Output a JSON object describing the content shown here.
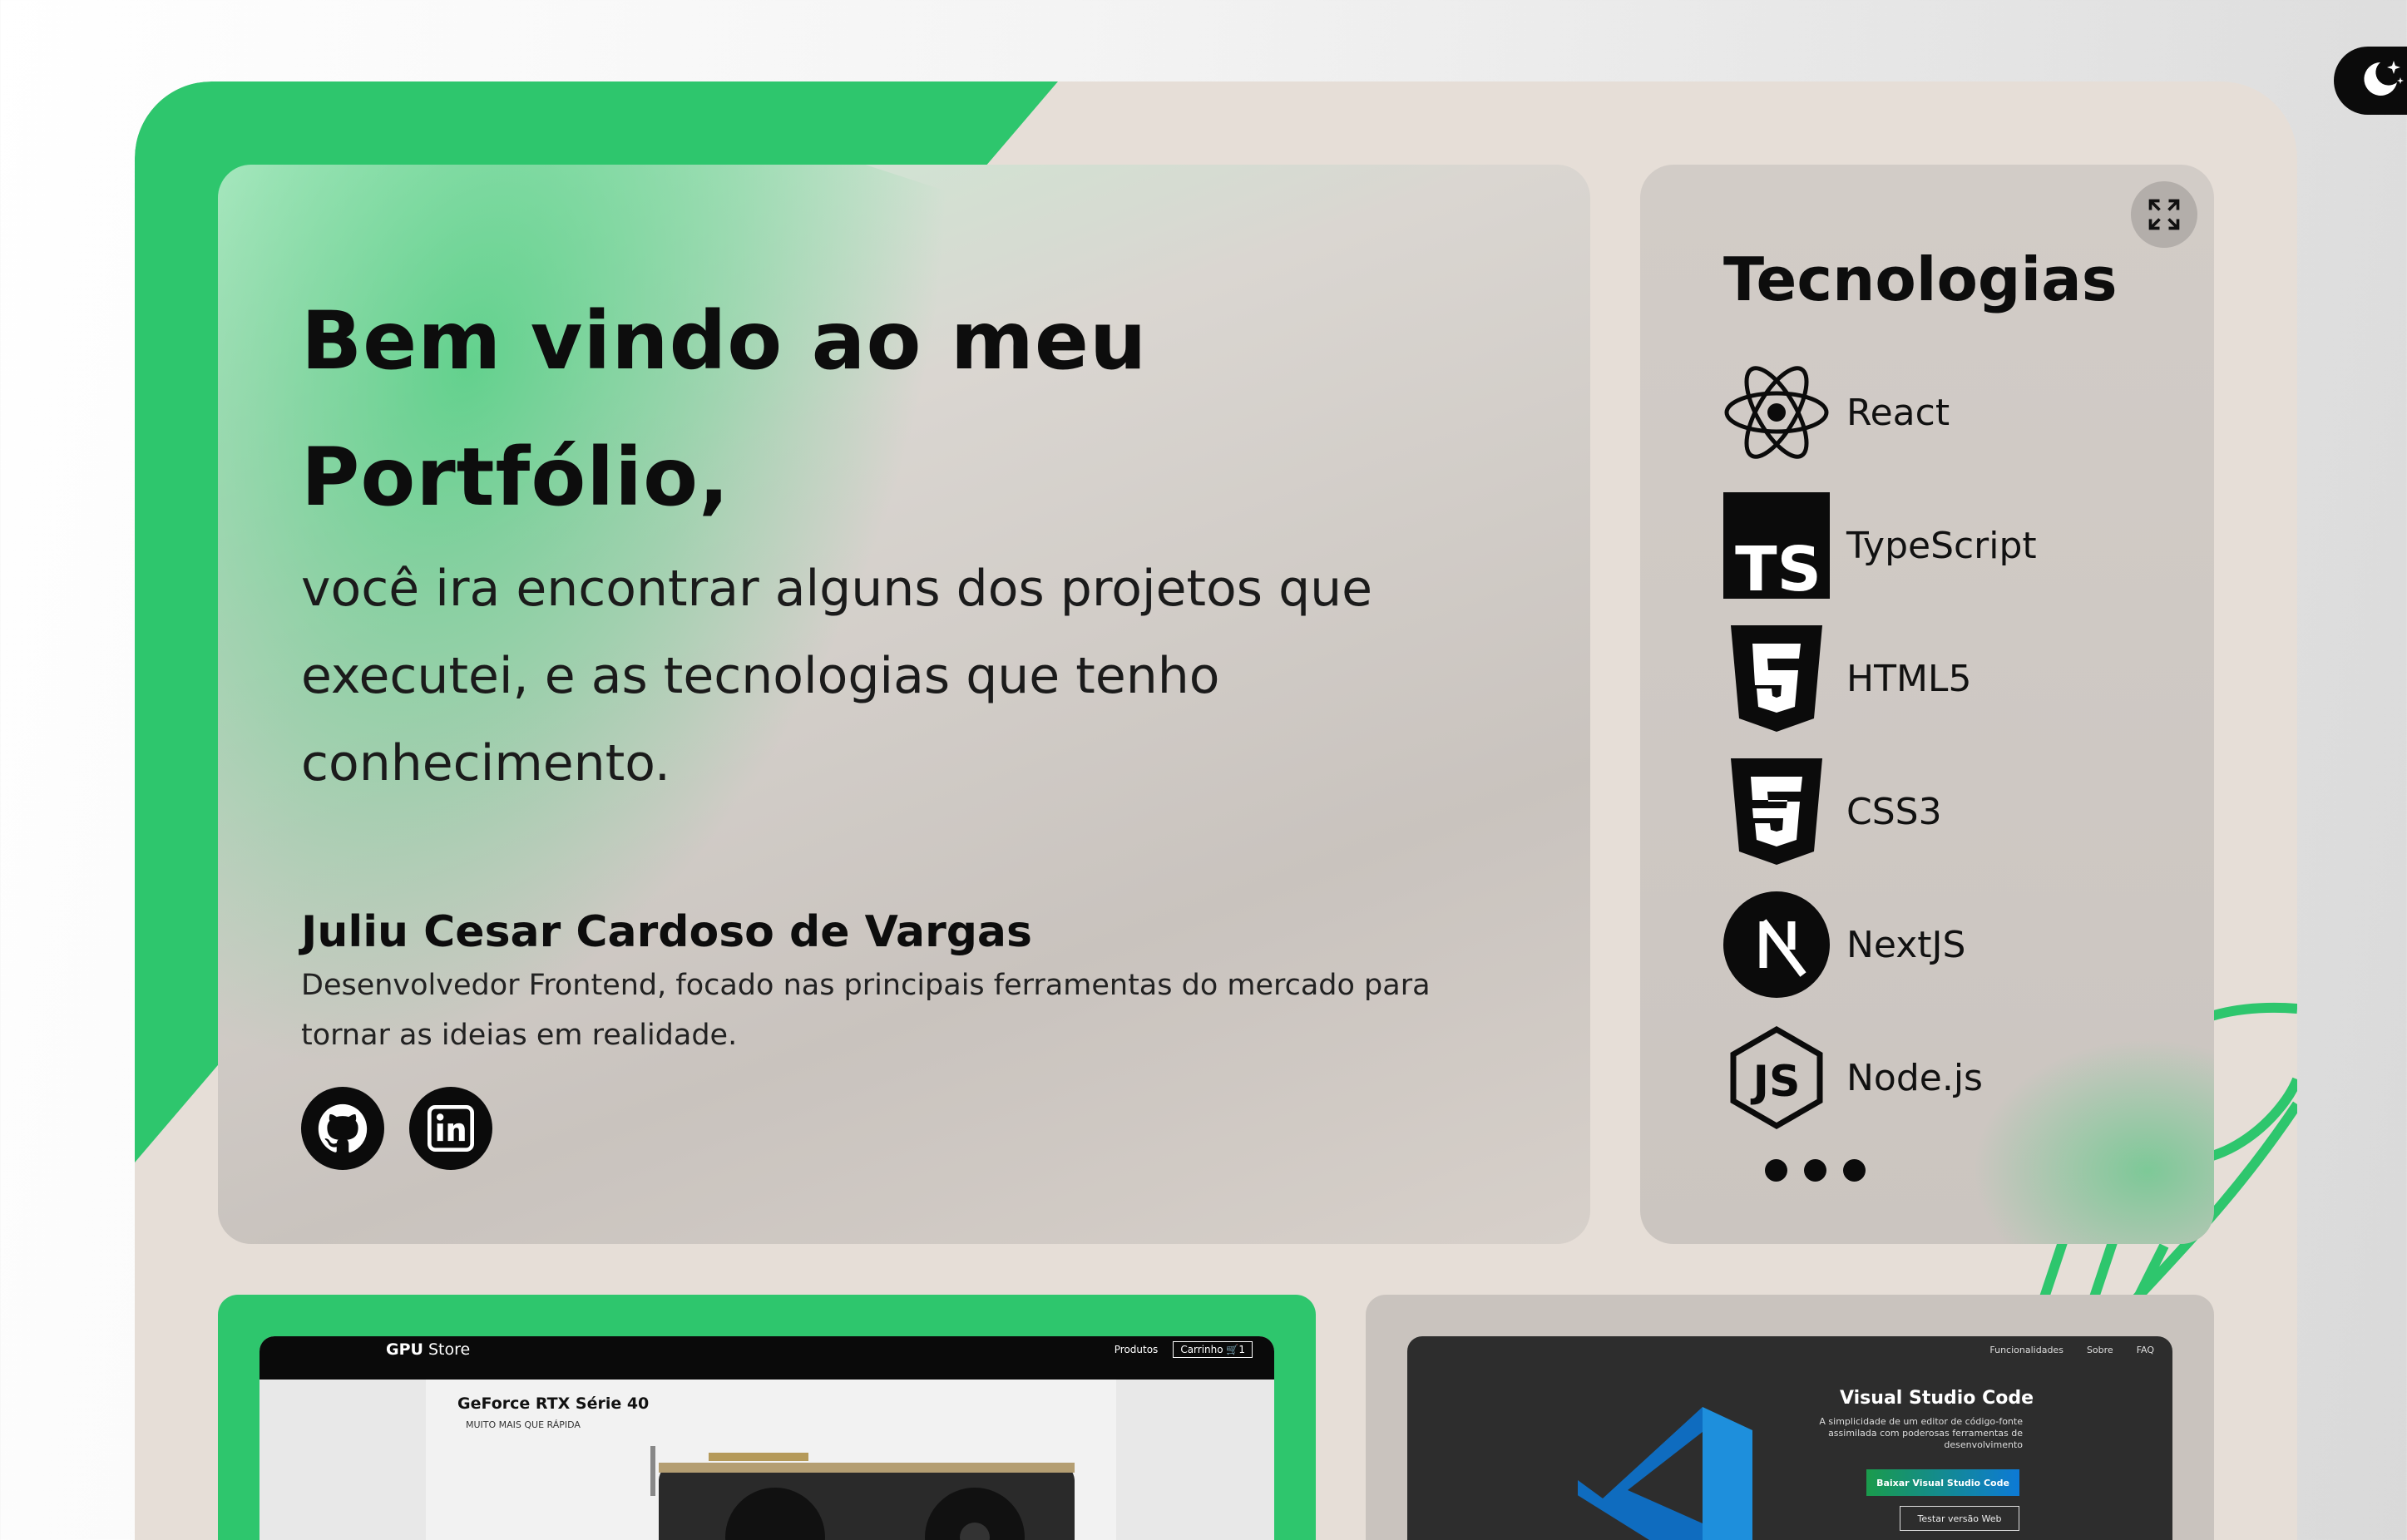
{
  "hero": {
    "title_line1": "Bem vindo ao meu",
    "title_line2": "Portfólio,",
    "intro": "você ira encontrar alguns dos projetos que executei, e as tecnologias que tenho conhecimento.",
    "name": "Juliu Cesar Cardoso de Vargas",
    "role": "Desenvolvedor Frontend, focado nas principais ferramentas do mercado para tornar as ideias em realidade."
  },
  "social": {
    "icons": [
      "github-icon",
      "linkedin-icon"
    ]
  },
  "tech": {
    "title": "Tecnologias",
    "items": [
      {
        "label": "React",
        "icon": "react-icon"
      },
      {
        "label": "TypeScript",
        "icon": "typescript-icon"
      },
      {
        "label": "HTML5",
        "icon": "html5-icon"
      },
      {
        "label": "CSS3",
        "icon": "css3-icon"
      },
      {
        "label": "NextJS",
        "icon": "nextjs-icon"
      },
      {
        "label": "Node.js",
        "icon": "nodejs-icon"
      }
    ],
    "expand_icon": "expand-icon",
    "more_icon": "more-dots-icon"
  },
  "theme_toggle": {
    "icon": "moon-stars-icon"
  },
  "projects": {
    "gpu_store": {
      "logo_bold": "GPU",
      "logo_rest": " Store",
      "nav_products": "Produtos",
      "nav_cart": "Carrinho",
      "cart_count": "1",
      "product_title": "GeForce RTX Série 40",
      "product_sub": "MUITO MAIS QUE RÁPIDA"
    },
    "vscode": {
      "nav": [
        "Funcionalidades",
        "Sobre",
        "FAQ"
      ],
      "title": "Visual Studio Code",
      "desc": "A simplicidade de um editor de código-fonte assimilada com poderosas ferramentas de desenvolvimento",
      "btn_download": "Baixar Visual Studio Code",
      "btn_web": "Testar versão Web"
    }
  },
  "colors": {
    "accent_green": "#2ec66d",
    "frame_bg": "#e6ded7",
    "dark": "#0b0b0b"
  }
}
